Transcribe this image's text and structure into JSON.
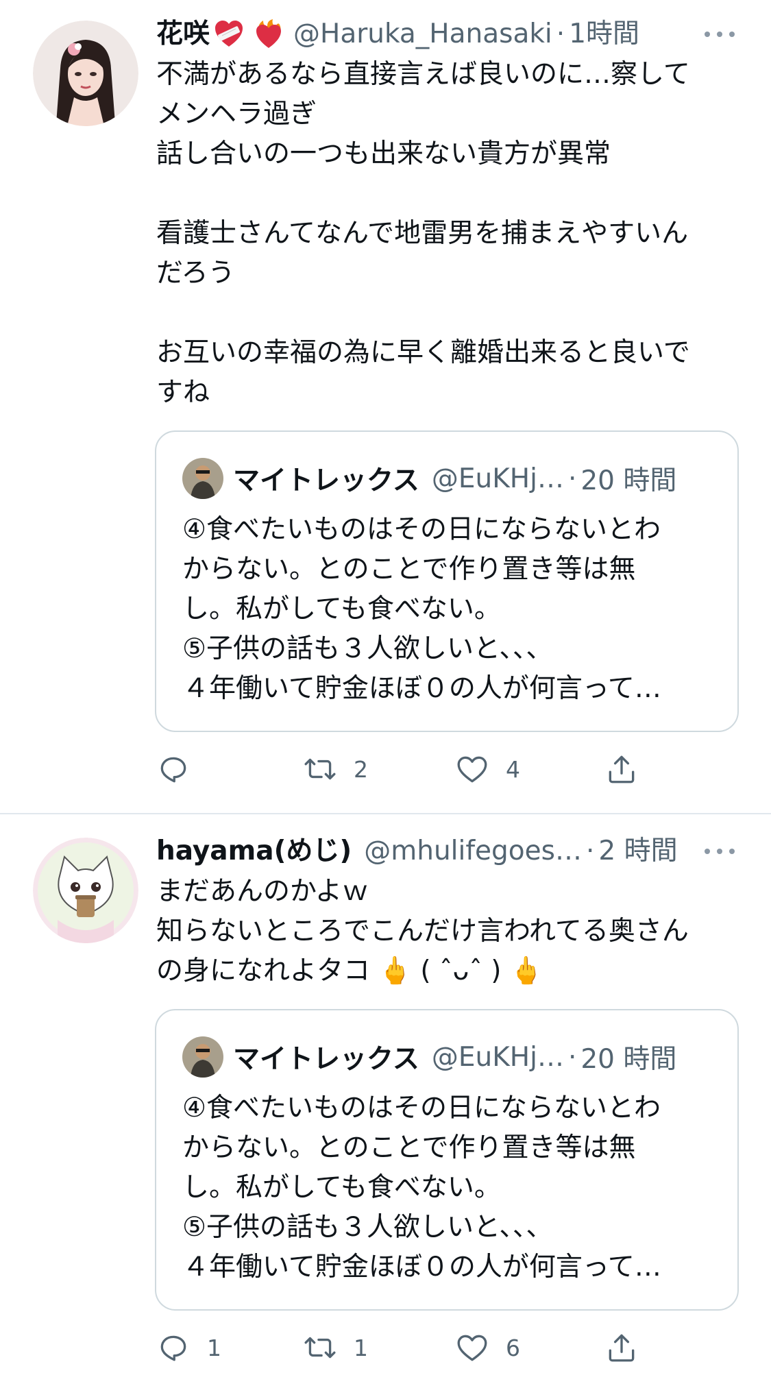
{
  "tweets": [
    {
      "display_name": "花咲",
      "name_emojis": [
        "mending-heart-icon",
        "heart-on-fire-icon"
      ],
      "handle": "@Haruka_Hanasaki",
      "separator": "·",
      "time": "1時間",
      "text": "不満があるなら直接言えば良いのに…察して\nメンヘラ過ぎ\n話し合いの一つも出来ない貴方が異常\n\n看護士さんてなんで地雷男を捕まえやすいん\nだろう\n\nお互いの幸福の為に早く離婚出来ると良いで\nすね",
      "quote": {
        "display_name": "マイトレックス",
        "handle": "@EuKHj…",
        "separator": "·",
        "time": "20 時間",
        "text": "④食べたいものはその日にならないとわ\nからない。とのことで作り置き等は無\nし。私がしても食べない。\n⑤子供の話も３人欲しいと、、、\n４年働いて貯金ほぼ０の人が何言って…"
      },
      "reply_count": "",
      "retweet_count": "2",
      "like_count": "4"
    },
    {
      "display_name": "hayama(めじ)",
      "handle": "@mhulifegoes…",
      "separator": "·",
      "time": "2 時間",
      "text": "まだあんのかよｗ\n知らないところでこんだけ言われてる奥さん\nの身になれよタコ 🖕 ( ˆᴗˆ ) 🖕",
      "quote": {
        "display_name": "マイトレックス",
        "handle": "@EuKHj…",
        "separator": "·",
        "time": "20 時間",
        "text": "④食べたいものはその日にならないとわ\nからない。とのことで作り置き等は無\nし。私がしても食べない。\n⑤子供の話も３人欲しいと、、、\n４年働いて貯金ほぼ０の人が何言って…"
      },
      "reply_count": "1",
      "retweet_count": "1",
      "like_count": "6"
    }
  ],
  "colors": {
    "text": "#0f1419",
    "secondary": "#536471",
    "border": "#cfd9de",
    "divider": "#e1e8ed",
    "icon": "#536471"
  }
}
